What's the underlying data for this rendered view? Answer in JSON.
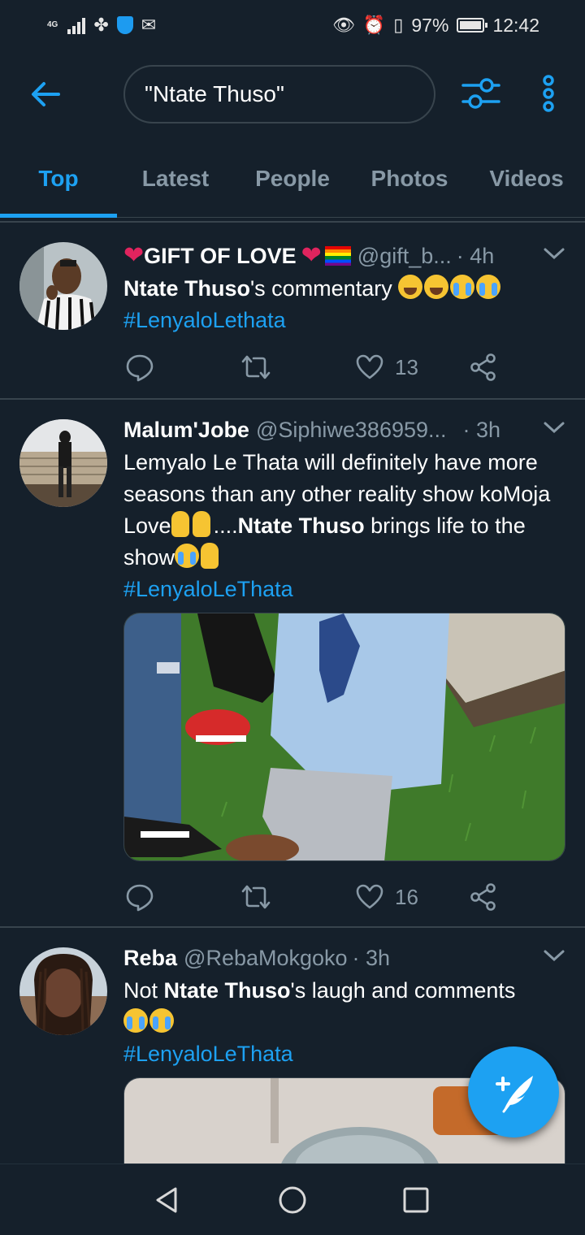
{
  "status_bar": {
    "network": "4G",
    "battery": "97%",
    "time": "12:42"
  },
  "search": {
    "query": "\"Ntate Thuso\""
  },
  "tabs": [
    {
      "label": "Top",
      "active": true
    },
    {
      "label": "Latest",
      "active": false
    },
    {
      "label": "People",
      "active": false
    },
    {
      "label": "Photos",
      "active": false
    },
    {
      "label": "Videos",
      "active": false
    }
  ],
  "tweets": [
    {
      "name": "GIFT OF LOVE",
      "handle": "@gift_b...",
      "time": "· 4h",
      "text_bold": "Ntate Thuso",
      "text": "'s commentary",
      "hashtag": "#LenyaloLethata",
      "likes": "13"
    },
    {
      "name": "Malum'Jobe",
      "handle": "@Siphiwe386959...",
      "time": "· 3h",
      "text": "Lemyalo Le Thata will definitely have more seasons than any other reality show koMoja Love",
      "text_mid": "....",
      "text_bold": "Ntate Thuso",
      "text_end": "brings life to the show",
      "hashtag": "#LenyaloLeThata",
      "likes": "16"
    },
    {
      "name": "Reba",
      "handle": "@RebaMokgoko",
      "time": "· 3h",
      "text_pre": "Not ",
      "text_bold": "Ntate Thuso",
      "text": "'s laugh and comments",
      "hashtag": "#LenyaloLeThata"
    }
  ],
  "colors": {
    "background": "#15202b",
    "accent": "#1da1f2",
    "muted": "#8899a6",
    "divider": "#38444d"
  }
}
